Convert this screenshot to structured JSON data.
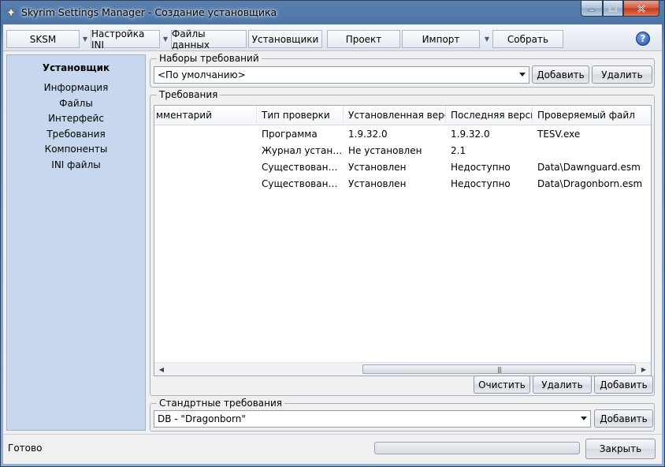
{
  "window": {
    "title": "Skyrim Settings Manager - Создание установщика"
  },
  "toolbar": {
    "buttons": [
      "SKSM",
      "Настройка INI",
      "Файлы данных",
      "Установщики",
      "Проект",
      "Импорт",
      "Собрать"
    ]
  },
  "sidebar": {
    "heading": "Установщик",
    "items": [
      "Информация",
      "Файлы",
      "Интерфейс",
      "Требования",
      "Компоненты",
      "INI файлы"
    ]
  },
  "requirement_sets": {
    "legend": "Наборы требований",
    "selected": "<По умолчанию>",
    "add_label": "Добавить",
    "delete_label": "Удалить"
  },
  "requirements": {
    "legend": "Требования",
    "columns": [
      "мментарий",
      "Тип проверки",
      "Установленная версия",
      "Последняя версия",
      "Проверяемый файл"
    ],
    "rows": [
      [
        "",
        "Программа",
        "1.9.32.0",
        "1.9.32.0",
        "TESV.exe"
      ],
      [
        "",
        "Журнал установки",
        "Не установлен",
        "2.1",
        ""
      ],
      [
        "",
        "Существование ...",
        "Установлен",
        "Недоступно",
        "Data\\Dawnguard.esm"
      ],
      [
        "",
        "Существование ...",
        "Установлен",
        "Недоступно",
        "Data\\Dragonborn.esm"
      ]
    ],
    "clear_label": "Очистить",
    "delete_label": "Удалить",
    "add_label": "Добавить"
  },
  "standard_requirements": {
    "legend": "Стандртные требования",
    "selected": "DB - \"Dragonborn\"",
    "add_label": "Добавить"
  },
  "status": {
    "text": "Готово",
    "progress": 0,
    "close_label": "Закрыть"
  },
  "icons": {
    "app": "skyrim-logo-icon",
    "help": "help-icon"
  },
  "colors": {
    "sidebar_bg": "#c7d8ee",
    "help_blue": "#1f4fa8"
  }
}
